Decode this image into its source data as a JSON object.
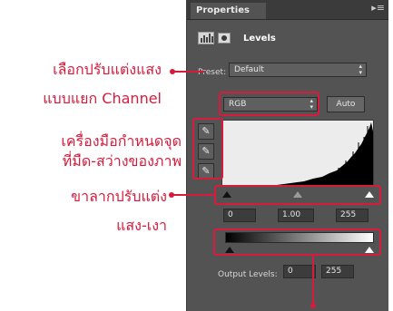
{
  "panel": {
    "tab_title": "Properties",
    "adjustment_title": "Levels",
    "preset_label": "Preset:",
    "preset_value": "Default",
    "channel_value": "RGB",
    "auto_label": "Auto",
    "input_black": "0",
    "input_gamma": "1.00",
    "input_white": "255",
    "output_label": "Output Levels:",
    "output_black": "0",
    "output_white": "255"
  },
  "annotations": {
    "preset_line1": "เลือกปรับแต่งแสง",
    "preset_line2": "แบบแยก Channel",
    "eyedropper_line1": "เครื่องมือกำหนดจุด",
    "eyedropper_line2": "ที่มืด-สว่างของภาพ",
    "slider_line1": "ขาลากปรับแต่ง",
    "slider_line2": "แสง-เงา"
  },
  "colors": {
    "accent": "#d81b3c",
    "panel_bg": "#535353"
  },
  "icons": [
    "levels-icon",
    "layer-mask-icon",
    "black-point-eyedropper-icon",
    "gray-point-eyedropper-icon",
    "white-point-eyedropper-icon"
  ]
}
